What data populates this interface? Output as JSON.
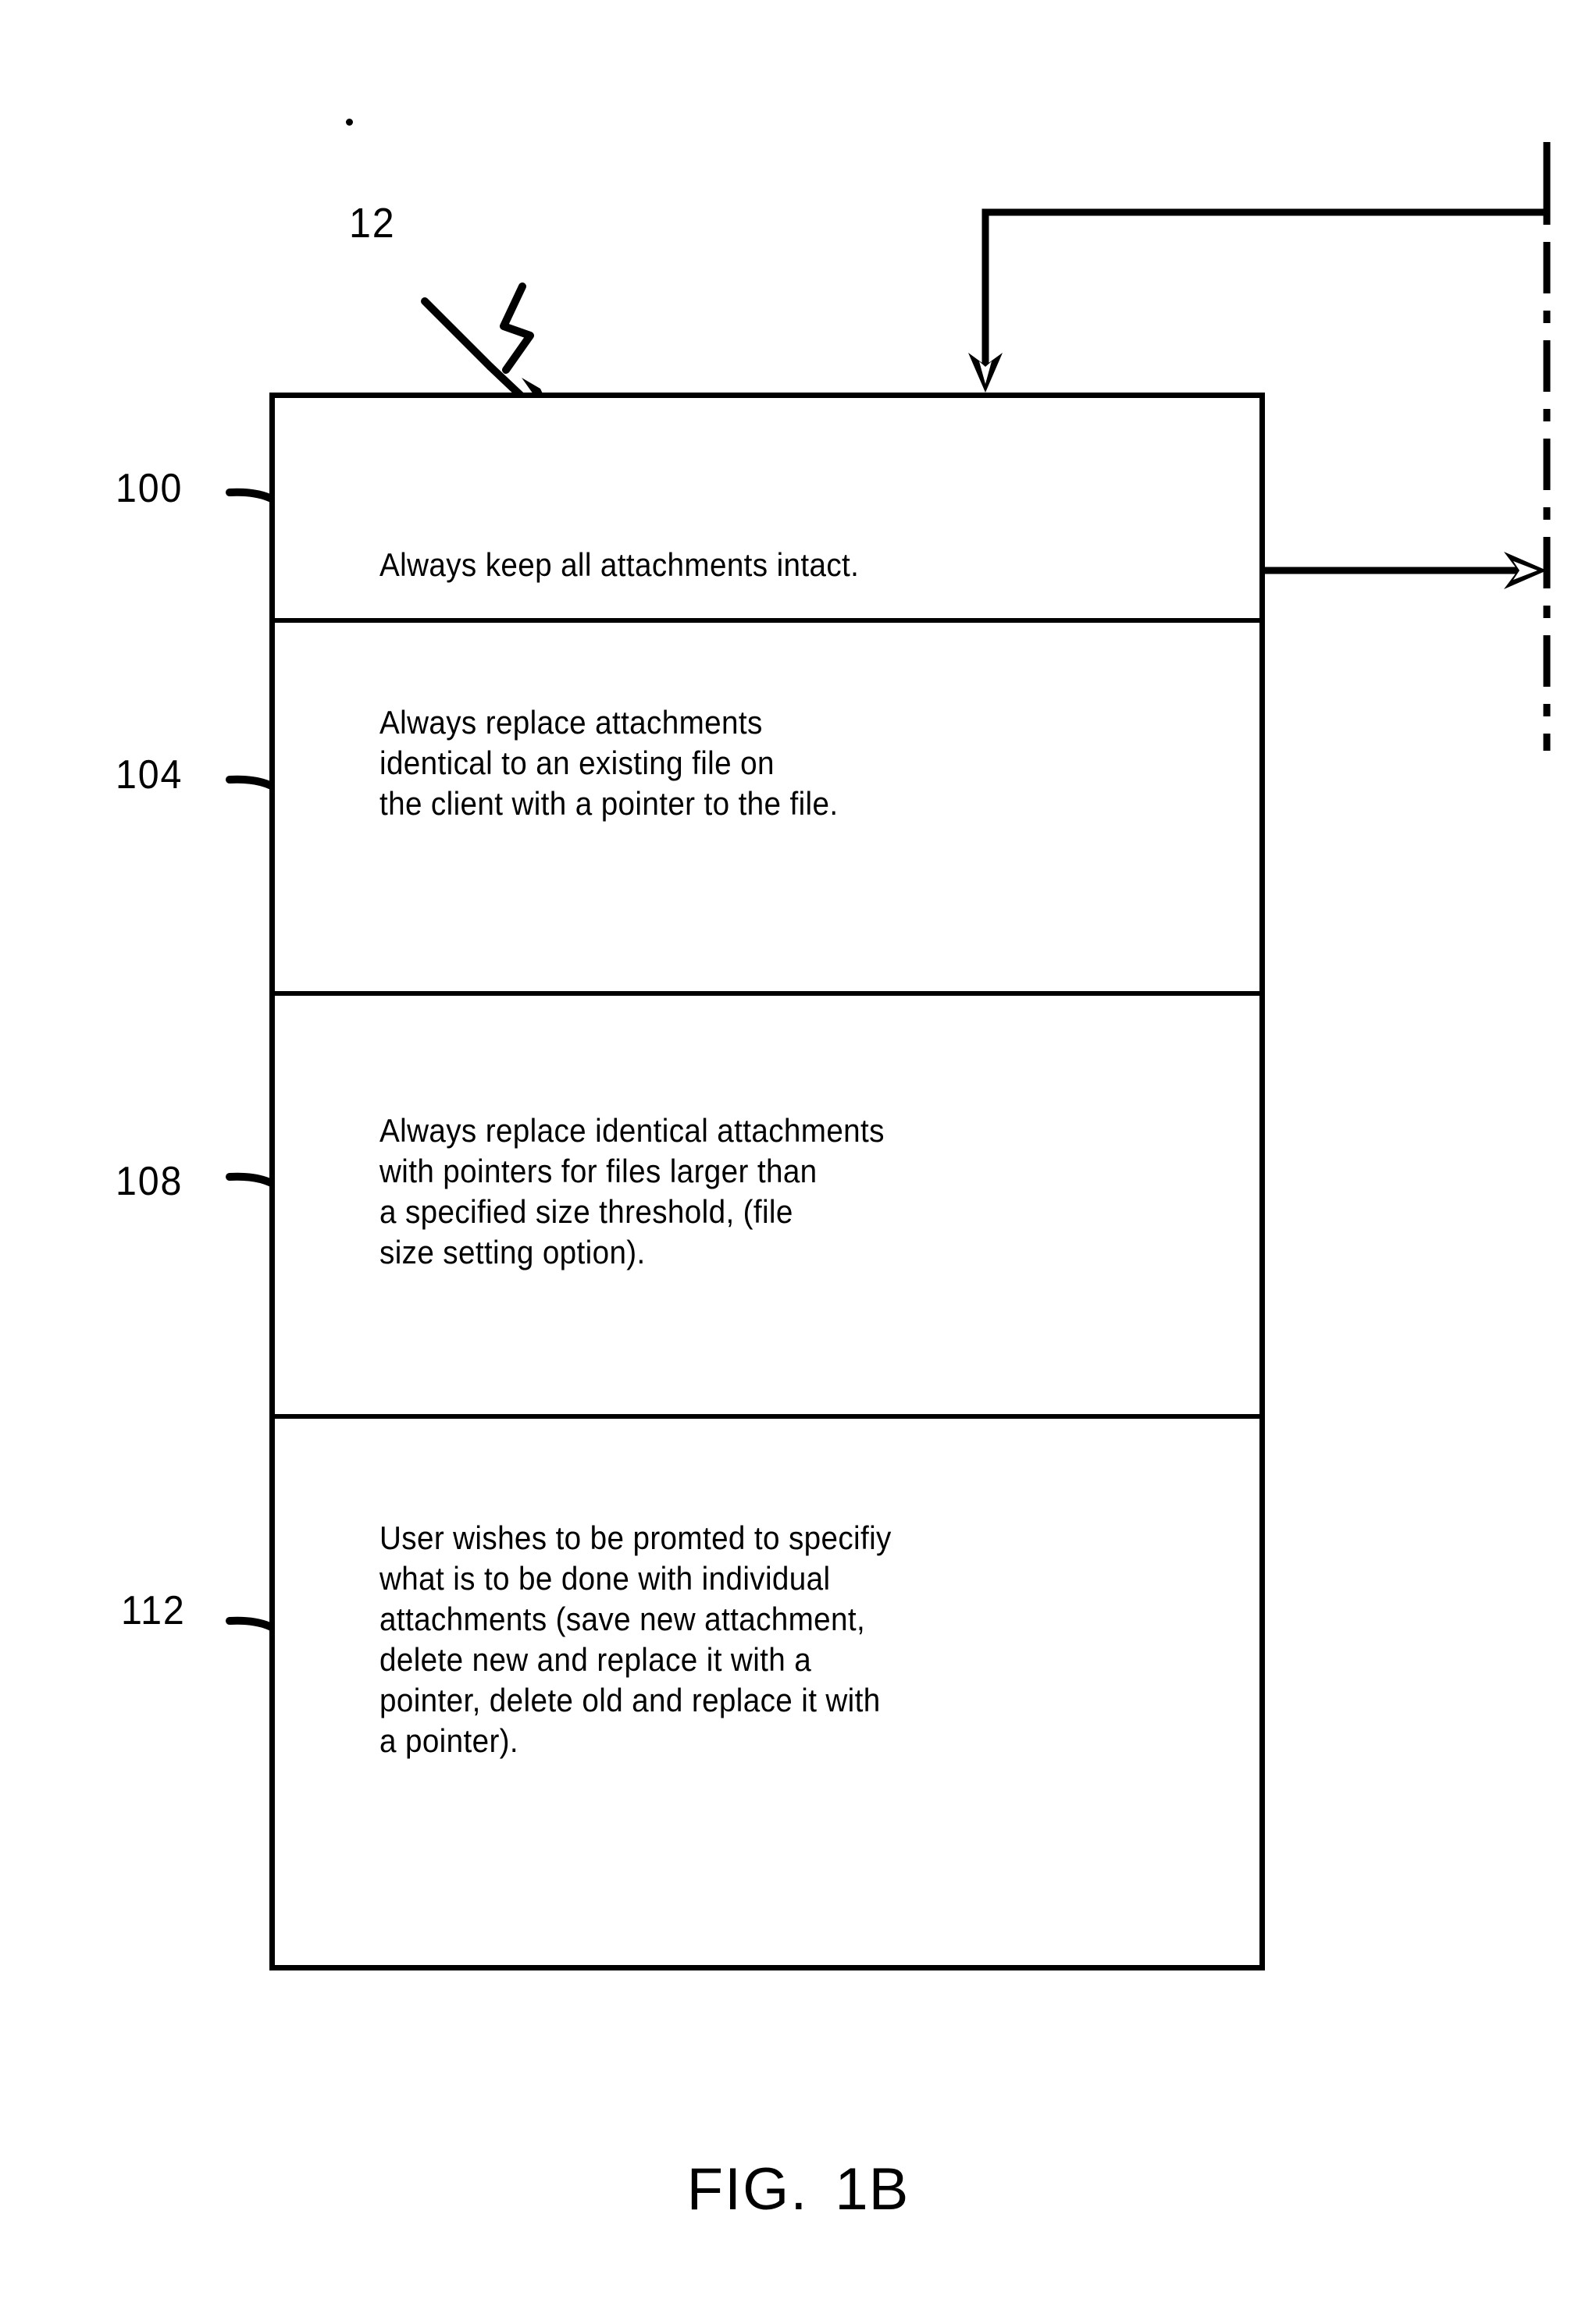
{
  "figure": {
    "caption_word": "FIG.",
    "caption_number": "1B",
    "assembly_ref": "12"
  },
  "option_box": {
    "rows": [
      {
        "ref": "100",
        "text": "Always keep all attachments intact."
      },
      {
        "ref": "104",
        "text": "Always replace attachments\nidentical to an existing file on\nthe client with a pointer to the file."
      },
      {
        "ref": "108",
        "text": "Always replace identical attachments\nwith pointers for files larger than\na specified size threshold, (file\nsize setting option)."
      },
      {
        "ref": "112",
        "text": "User wishes to be promted to specifiy\nwhat is to be done with individual\nattachments (save new attachment,\ndelete new and replace it with a\npointer, delete old and replace it with\na pointer)."
      }
    ]
  },
  "connectors": {
    "inbound_label": "inbound-flow-arrow",
    "outbound_label": "outbound-flow-arrow",
    "bus_label": "dashed-system-bus"
  },
  "colors": {
    "ink": "#000000",
    "paper": "#ffffff"
  }
}
